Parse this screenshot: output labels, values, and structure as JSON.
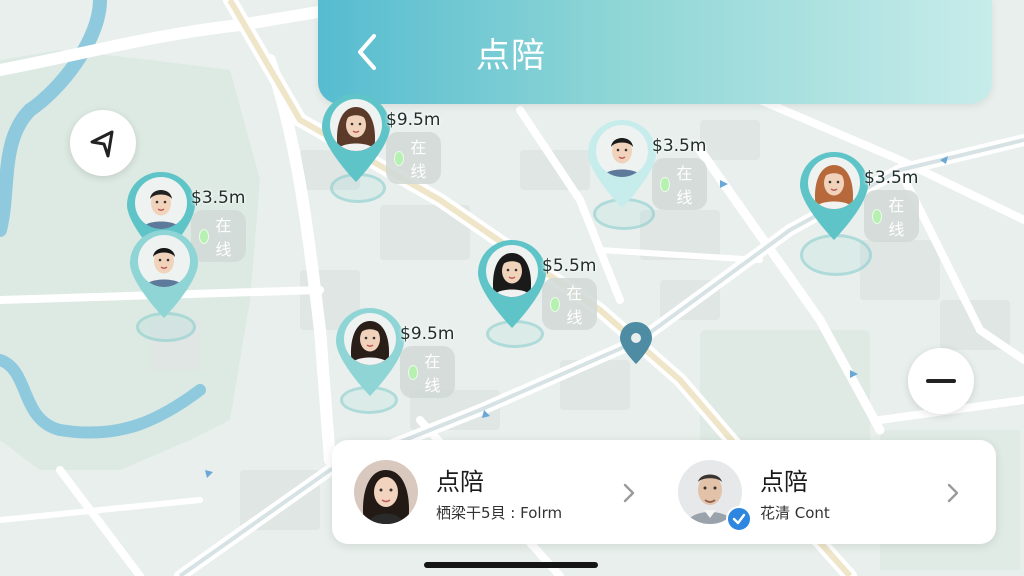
{
  "header": {
    "title": "点陪"
  },
  "pins": [
    {
      "id": "p1",
      "distance": "$9.5m",
      "status": "在线",
      "gender": "f",
      "hair": "#5b3a29"
    },
    {
      "id": "p2",
      "distance": "$3.5m",
      "status": "在线",
      "gender": "m",
      "hair": "#222222"
    },
    {
      "id": "p3",
      "distance": "$3.5m",
      "status": "在线",
      "gender": "f",
      "hair": "#b8693b"
    },
    {
      "id": "p4",
      "distance": "$3.5m",
      "status": "在线",
      "gender": "m",
      "hair": "#1b1b1b"
    },
    {
      "id": "p5",
      "distance": "",
      "status": "",
      "gender": "m",
      "hair": "#161616"
    },
    {
      "id": "p6",
      "distance": "$5.5m",
      "status": "在线",
      "gender": "f",
      "hair": "#1a1a1a"
    },
    {
      "id": "p7",
      "distance": "$9.5m",
      "status": "在线",
      "gender": "f",
      "hair": "#2a1e18"
    }
  ],
  "cards": [
    {
      "name": "点陪",
      "desc": "栖梁干5貝 : Folrm"
    },
    {
      "name": "点陪",
      "desc": "花清 Cont"
    }
  ],
  "colors": {
    "accent": "#5fc4c8",
    "header_start": "#56bcd0",
    "header_end": "#c7ecea",
    "online_dot": "#b6f1b1",
    "verified": "#2f86e0",
    "map_bg": "#e8efec",
    "water": "#8ec9de",
    "road": "#ffffff"
  }
}
